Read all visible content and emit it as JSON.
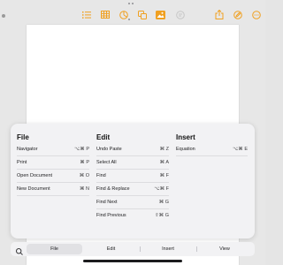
{
  "toolbar": {
    "icons": [
      "list-icon",
      "table-icon",
      "chart-icon",
      "shapes-icon",
      "media-icon",
      "comment-icon",
      "share-icon",
      "pen-icon",
      "more-icon"
    ],
    "accent_color": "#f0a020"
  },
  "panel": {
    "columns": [
      {
        "title": "File",
        "rows": [
          {
            "label": "Navigator",
            "shortcut": "⌥⌘ P"
          },
          {
            "label": "Print",
            "shortcut": "⌘ P"
          },
          {
            "label": "Open Document",
            "shortcut": "⌘ O"
          },
          {
            "label": "New Document",
            "shortcut": "⌘ N"
          }
        ]
      },
      {
        "title": "Edit",
        "rows": [
          {
            "label": "Undo Paste",
            "shortcut": "⌘ Z"
          },
          {
            "label": "Select All",
            "shortcut": "⌘ A"
          },
          {
            "label": "Find",
            "shortcut": "⌘ F"
          },
          {
            "label": "Find & Replace",
            "shortcut": "⌥⌘ F"
          },
          {
            "label": "Find Next",
            "shortcut": "⌘ G"
          },
          {
            "label": "Find Previous",
            "shortcut": "⇧⌘ G"
          }
        ]
      },
      {
        "title": "Insert",
        "rows": [
          {
            "label": "Equation",
            "shortcut": "⌥⌘ E"
          }
        ]
      }
    ]
  },
  "tabbar": {
    "tabs": [
      {
        "label": "File",
        "active": true
      },
      {
        "label": "Edit",
        "active": false
      },
      {
        "label": "Insert",
        "active": false
      },
      {
        "label": "View",
        "active": false
      }
    ]
  }
}
